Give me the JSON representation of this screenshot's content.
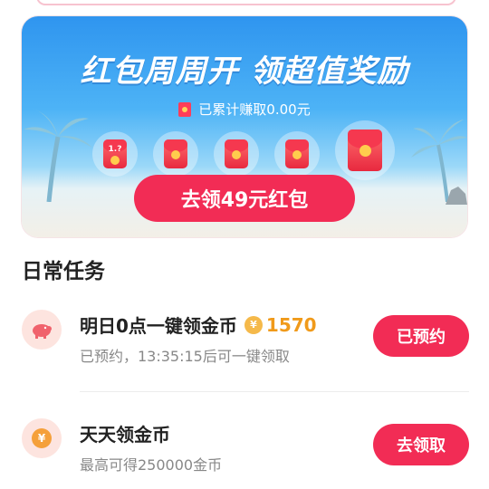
{
  "banner": {
    "title": "红包周周开 领超值奖励",
    "earned_text": "已累计赚取0.00元",
    "packet_mystery_label": "1.?",
    "cta_label": "去领49元红包"
  },
  "section": {
    "title": "日常任务"
  },
  "tasks": [
    {
      "title": "明日0点一键领金币",
      "coin_symbol": "¥",
      "coin_count": "1570",
      "subtitle": "已预约，13:35:15后可一键领取",
      "button_label": "已预约",
      "icon": "piggy-bank-icon"
    },
    {
      "title": "天天领金币",
      "subtitle": "最高可得250000金币",
      "button_label": "去领取",
      "icon": "yen-coin-icon"
    }
  ],
  "colors": {
    "accent": "#f22c55",
    "coin": "#f09a1a",
    "banner_sky": "#2f95ef"
  }
}
